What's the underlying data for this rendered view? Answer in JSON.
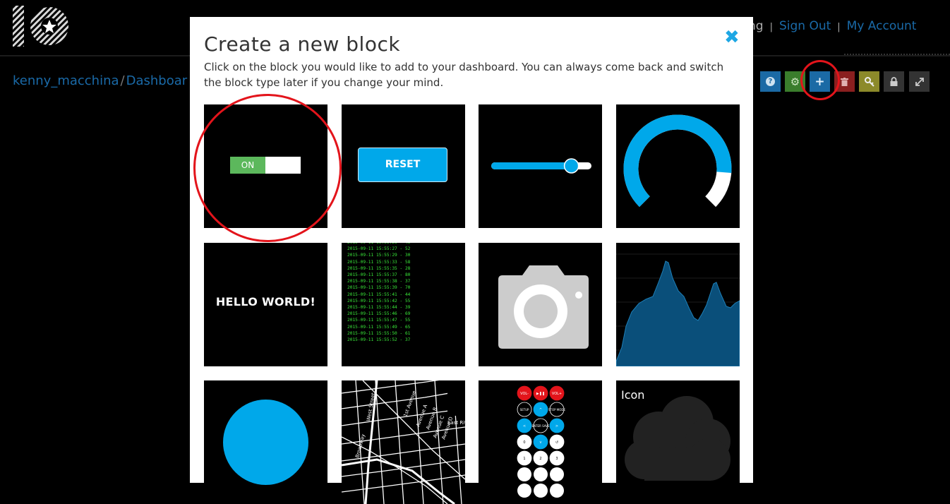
{
  "header": {
    "logo_icon": "io-logo-icon",
    "links": [
      {
        "label": "ng"
      },
      {
        "label": "Sign Out"
      },
      {
        "label": "My Account"
      }
    ]
  },
  "breadcrumb": {
    "user": "kenny_macchina",
    "separator": "/",
    "page": "Dashboar"
  },
  "toolbar": {
    "buttons": [
      {
        "icon": "help-icon",
        "color": "#1b6aa5"
      },
      {
        "icon": "gear-icon",
        "color": "#3a7d2c"
      },
      {
        "icon": "plus-icon",
        "color": "#1b6aa5"
      },
      {
        "icon": "trash-icon",
        "color": "#8a1f1f"
      },
      {
        "icon": "key-icon",
        "color": "#8c8a2a"
      },
      {
        "icon": "lock-icon",
        "color": "#333333"
      },
      {
        "icon": "expand-icon",
        "color": "#333333"
      }
    ]
  },
  "modal": {
    "title": "Create a new block",
    "close_icon": "close-icon",
    "description": "Click on the block you would like to add to your dashboard. You can always come back and switch the block type later if you change your mind.",
    "blocks": {
      "toggle": {
        "on_label": "ON"
      },
      "momentary_button": {
        "label": "RESET"
      },
      "slider": {
        "value": 0.8
      },
      "gauge": {
        "value": 0.85
      },
      "text": {
        "label": "HELLO WORLD!"
      },
      "stream": {
        "lines": [
          "2015-09-11 15:55:26 - 46",
          "2015-09-11 15:55:27 - 52",
          "2015-09-11 15:55:29 - 30",
          "2015-09-11 15:55:33 - 58",
          "2015-09-11 15:55:35 - 28",
          "2015-09-11 15:55:37 - 80",
          "2015-09-11 15:55:38 - 37",
          "2015-09-11 15:55:39 - 70",
          "2015-09-11 15:55:41 - 44",
          "2015-09-11 15:55:42 - 55",
          "2015-09-11 15:55:44 - 39",
          "2015-09-11 15:55:46 - 69",
          "2015-09-11 15:55:47 - 55",
          "2015-09-11 15:55:49 - 65",
          "2015-09-11 15:55:50 - 61",
          "2015-09-11 15:55:52 - 37"
        ]
      },
      "image": {
        "icon": "camera-icon"
      },
      "line_chart": {
        "icon": "area-chart-icon"
      },
      "color": {
        "color": "#00a8ea"
      },
      "map": {
        "streets": [
          "West Street",
          "Broadway",
          "1st Avenue",
          "Avenue A",
          "Avenue B",
          "Avenue C",
          "Avenue D",
          "East Riv"
        ]
      },
      "remote": {
        "keys": [
          [
            "VOL-",
            "▶❚❚",
            "VOL+"
          ],
          [
            "SETUP",
            "^",
            "STOP MODE"
          ],
          [
            "<",
            "ENTER SAVE",
            ">"
          ],
          [
            "0",
            "v",
            "↺"
          ],
          [
            "1",
            "2",
            "3"
          ]
        ]
      },
      "icon": {
        "label": "Icon",
        "icon": "cloud-icon"
      }
    }
  }
}
